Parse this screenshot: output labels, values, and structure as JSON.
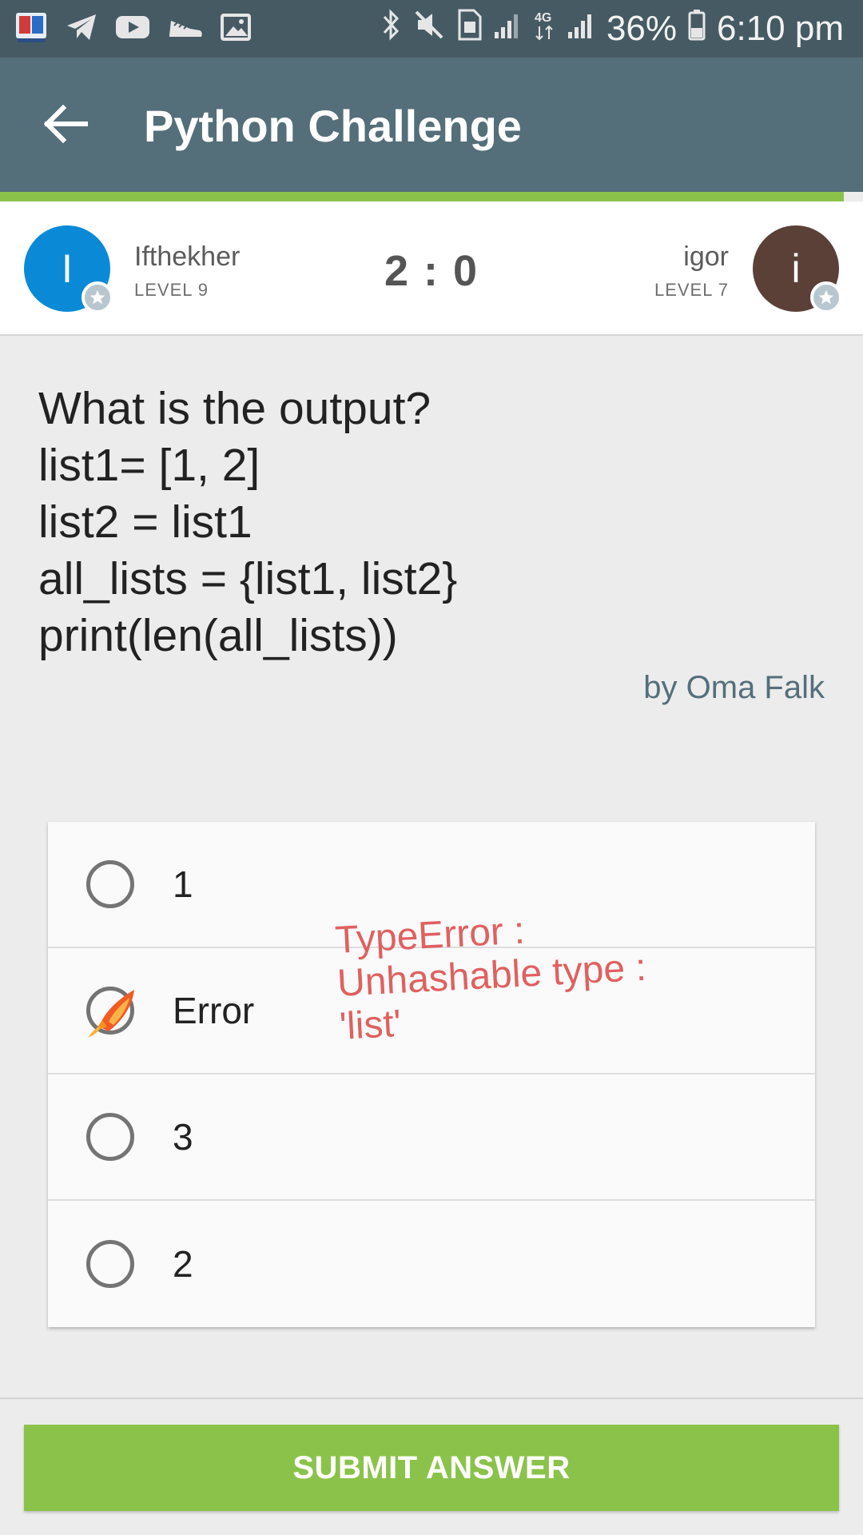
{
  "status_bar": {
    "battery_percent": "36%",
    "time": "6:10 pm",
    "icons_left": [
      "app-book-icon",
      "telegram-icon",
      "youtube-icon",
      "sneaker-icon",
      "gallery-icon"
    ],
    "icons_right": [
      "bluetooth-icon",
      "mute-icon",
      "sim-icon",
      "signal-icon",
      "4g-icon",
      "signal-icon",
      "battery-icon"
    ]
  },
  "app_bar": {
    "title": "Python Challenge",
    "back_icon": "arrow-back-icon"
  },
  "players": {
    "left": {
      "initial": "I",
      "name": "Ifthekher",
      "level": "LEVEL 9",
      "color": "#0a8ad6"
    },
    "right": {
      "initial": "i",
      "name": "igor",
      "level": "LEVEL 7",
      "color": "#5b4038"
    },
    "score": "2 : 0"
  },
  "question": {
    "lines": [
      "What is the output?",
      "list1= [1, 2]",
      "list2 = list1",
      "all_lists = {list1, list2}",
      "print(len(all_lists))"
    ],
    "author": "by Oma Falk"
  },
  "options": [
    {
      "label": "1",
      "selected": false
    },
    {
      "label": "Error",
      "selected": true
    },
    {
      "label": "3",
      "selected": false
    },
    {
      "label": "2",
      "selected": false
    }
  ],
  "annotation": {
    "lines": [
      "TypeError :",
      "Unhashable type :",
      "'list'"
    ],
    "color": "#e06060"
  },
  "submit": {
    "label": "SUBMIT ANSWER",
    "color": "#8bc34a"
  },
  "colors": {
    "status_bar": "#465a64",
    "app_bar": "#546f7a",
    "accent": "#8bc34a"
  }
}
